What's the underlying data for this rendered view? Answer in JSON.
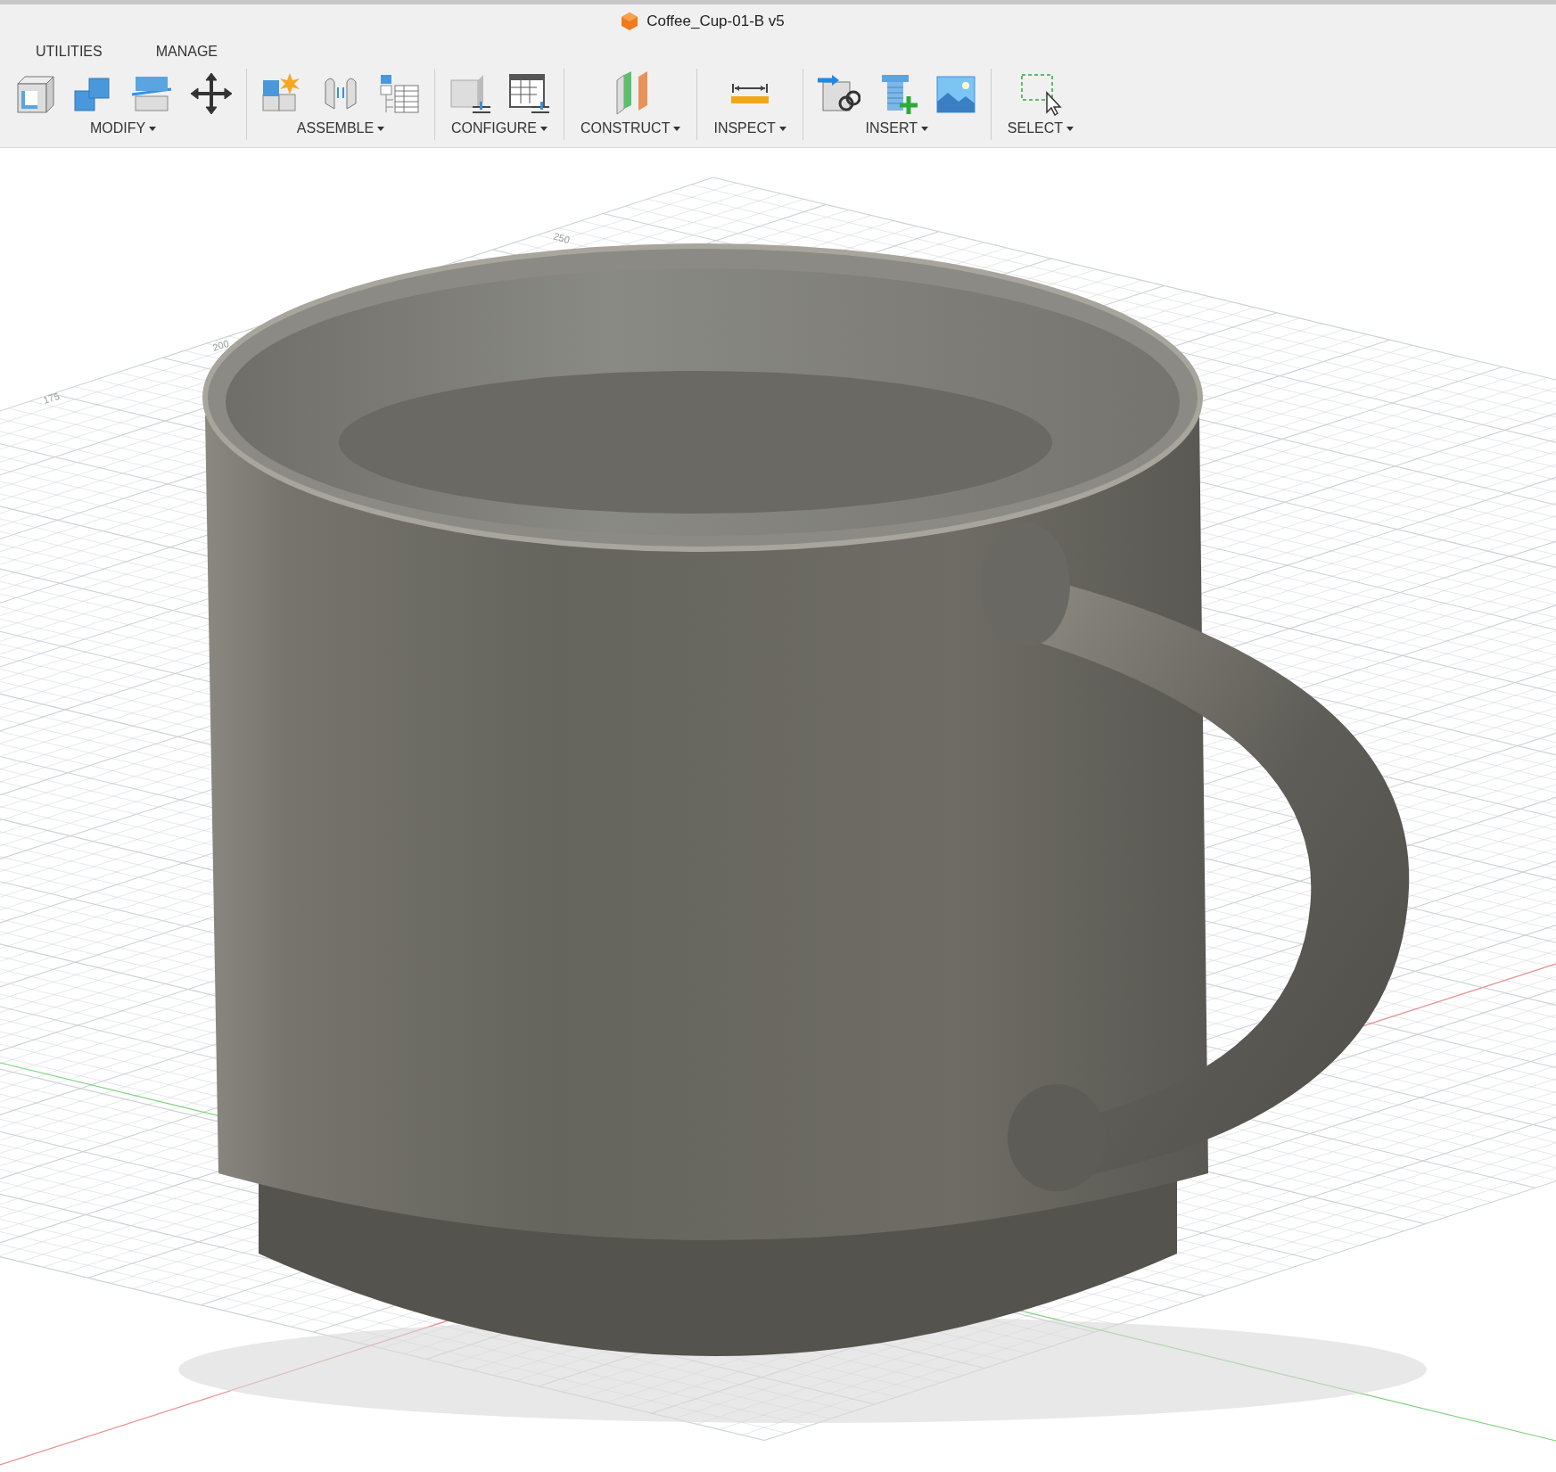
{
  "window": {
    "title": "Coffee_Cup-01-B v5"
  },
  "tabs": [
    {
      "label": "UTILITIES"
    },
    {
      "label": "MANAGE"
    }
  ],
  "toolbar_groups": [
    {
      "label": "MODIFY"
    },
    {
      "label": "ASSEMBLE"
    },
    {
      "label": "CONFIGURE"
    },
    {
      "label": "CONSTRUCT"
    },
    {
      "label": "INSPECT"
    },
    {
      "label": "INSERT"
    },
    {
      "label": "SELECT"
    }
  ],
  "viewport": {
    "grid_labels": [
      "250",
      "200",
      "175"
    ]
  }
}
